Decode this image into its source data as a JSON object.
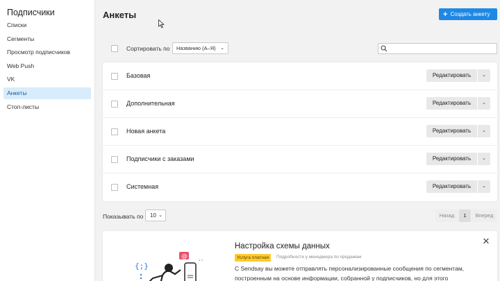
{
  "sidebar": {
    "title": "Подписчики",
    "items": [
      {
        "label": "Списки"
      },
      {
        "label": "Сегменты"
      },
      {
        "label": "Просмотр подписчиков"
      },
      {
        "label": "Web Push"
      },
      {
        "label": "VK"
      },
      {
        "label": "Анкеты",
        "active": true
      },
      {
        "label": "Стоп-листы"
      }
    ]
  },
  "header": {
    "title": "Анкеты",
    "create_button": "Создать анкету",
    "create_icon": "plus-icon"
  },
  "toolbar": {
    "sort_label": "Сортировать по",
    "sort_value": "Названию (А–Я)",
    "search_icon": "search-icon",
    "search_value": ""
  },
  "forms": [
    {
      "name": "Базовая",
      "action": "Редактировать"
    },
    {
      "name": "Дополнительная",
      "action": "Редактировать"
    },
    {
      "name": "Новая анкета",
      "action": "Редактировать"
    },
    {
      "name": "Подписчики с заказами",
      "action": "Редактировать"
    },
    {
      "name": "Системная",
      "action": "Редактировать"
    }
  ],
  "pagination": {
    "show_label": "Показывать по",
    "per_page": "10",
    "prev": "Назад",
    "current": "1",
    "next": "Вперед"
  },
  "promo": {
    "title": "Настройка схемы данных",
    "badge": "Услуга платная",
    "note": "Подробности у менеджера по продажам",
    "text": "С Sendsay вы можете отправлять персонализированные сообщения по сегментам, построенным на основе информации, собранной у подписчиков, но для этого",
    "close_icon": "close-icon"
  },
  "colors": {
    "accent": "#1e88e5",
    "active_bg": "#d9ecfb",
    "badge": "#ffcb2f"
  }
}
